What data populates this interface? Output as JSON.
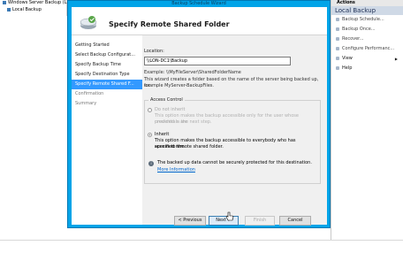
{
  "console": {
    "tree_title": "Windows Server Backup (L",
    "tree_item": "Local Backup",
    "actions_header": "Actions",
    "actions_subheader": "Local Backup",
    "actions": [
      {
        "label": "Backup Schedule...",
        "dark": false
      },
      {
        "label": "Backup Once...",
        "dark": false
      },
      {
        "label": "Recover...",
        "dark": false
      },
      {
        "label": "Configure Performanc...",
        "dark": false
      },
      {
        "label": "View",
        "dark": true,
        "arrow": "▶"
      },
      {
        "label": "Help",
        "dark": true
      }
    ]
  },
  "wizard": {
    "title": "Backup Schedule Wizard",
    "header_title": "Specify Remote Shared Folder",
    "nav": [
      {
        "label": "Getting Started",
        "state": "normal"
      },
      {
        "label": "Select Backup Configurat...",
        "state": "normal"
      },
      {
        "label": "Specify Backup Time",
        "state": "normal"
      },
      {
        "label": "Specify Destination Type",
        "state": "normal"
      },
      {
        "label": "Specify Remote Shared F...",
        "state": "active"
      },
      {
        "label": "Confirmation",
        "state": "dim"
      },
      {
        "label": "Summary",
        "state": "dim"
      }
    ],
    "location_label": "Location:",
    "location_value": "\\\\LON-DC1\\Backup",
    "example": "Example: \\\\MyFileServer\\SharedFolderName",
    "folder_note_1": "This wizard creates a folder based on the name of the server being backed up, for",
    "folder_note_2": "example MyServer-BackupFiles.",
    "access_control": {
      "title": "Access Control",
      "do_not_inherit": "Do not inherit",
      "do_not_inherit_desc_1": "This option makes the backup accessible only for the user whose credentials are",
      "do_not_inherit_desc_2": "provided in the next step.",
      "inherit": "Inherit",
      "inherit_desc_1": "This option makes the backup accessible to everybody who has access to the",
      "inherit_desc_2": "specified remote shared folder."
    },
    "info_text": "The backed up data cannot be securely protected for this destination.",
    "info_link": "More Information",
    "buttons": {
      "previous": "< Previous",
      "next": "Next >",
      "finish": "Finish",
      "cancel": "Cancel"
    }
  },
  "colors": {
    "wizard_frame": "#00a4e8",
    "nav_active": "#3399ff",
    "actions_sub_bg": "#cfd9e6"
  }
}
